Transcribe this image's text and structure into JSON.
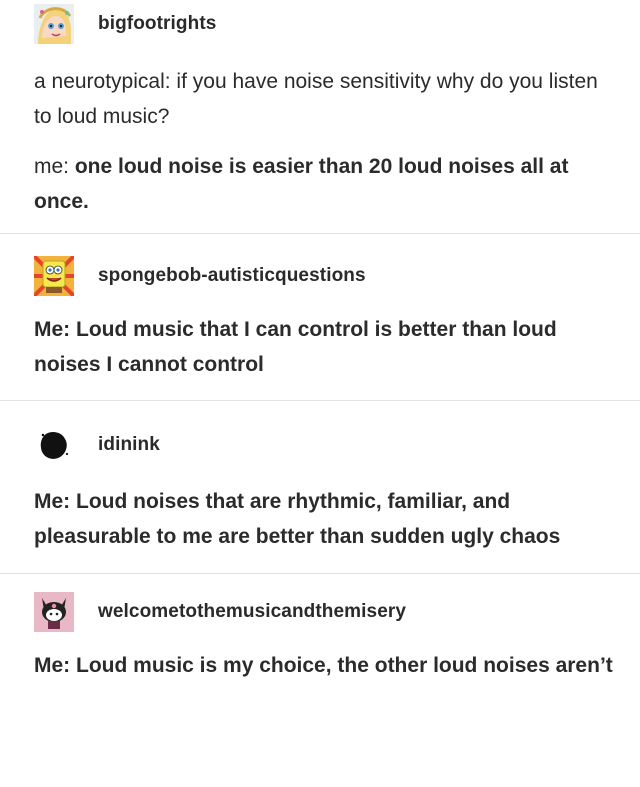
{
  "posts": [
    {
      "username": "bigfootrights",
      "avatar_icon": "cartoon-avatar-icon",
      "lines": [
        {
          "speaker": "a neurotypical:",
          "text": " if you have noise sensitivity why do you listen to loud music?"
        },
        {
          "speaker": "me:",
          "text": " one loud noise is easier than 20 loud noises all at once."
        }
      ]
    },
    {
      "username": "spongebob-autisticquestions",
      "avatar_icon": "spongebob-avatar-icon",
      "text": "Me: Loud music that I can control is better than loud noises I cannot control"
    },
    {
      "username": "idinink",
      "avatar_icon": "black-blob-avatar-icon",
      "text": "Me: Loud noises that are rhythmic, familiar, and pleasurable to me are better than sudden ugly chaos"
    },
    {
      "username": "welcometothemusicandthemisery",
      "avatar_icon": "kuromi-avatar-icon",
      "text": "Me: Loud music is my choice, the other loud noises aren’t"
    }
  ],
  "colors": {
    "text": "#2b2b2b",
    "divider": "#e2e2e2",
    "background": "#ffffff"
  }
}
